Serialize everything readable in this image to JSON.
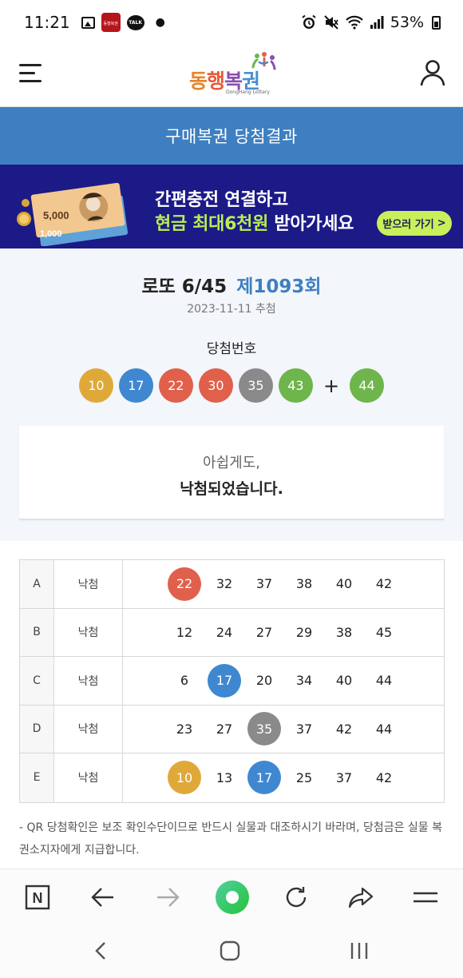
{
  "status_bar": {
    "time": "11:21",
    "app_icon_text": "동행복권",
    "talk_badge": "TALK",
    "battery": "53%"
  },
  "header": {
    "logo_text": [
      "동",
      "행",
      "복",
      "권"
    ],
    "logo_subtitle": "DongHang Lottery"
  },
  "title_band": "구매복권 당첨결과",
  "banner": {
    "line1": "간편충전 연결하고",
    "line2_highlight": "현금 최대6천원",
    "line2_rest": "받아가세요",
    "cta": "받으러 가기",
    "cta_arrow": ">",
    "bill_5000": "5,000",
    "bill_1000": "1,000"
  },
  "draw": {
    "game": "로또 6/45",
    "round": "제1093회",
    "date": "2023-11-11 추첨",
    "winning_label": "당첨번호",
    "numbers": [
      "10",
      "17",
      "22",
      "30",
      "35",
      "43"
    ],
    "plus": "+",
    "bonus": "44"
  },
  "colors": {
    "yellow": "#dfa93a",
    "blue": "#3f88d1",
    "red": "#e0604c",
    "gray": "#8a8a8a",
    "green": "#6eb54c",
    "band": "#3e7fc1",
    "banner_bg": "#1c1a86"
  },
  "message": {
    "line1": "아쉽게도,",
    "line2": "낙첨되었습니다."
  },
  "tickets": [
    {
      "game": "A",
      "result": "낙첨",
      "numbers": [
        "22",
        "32",
        "37",
        "38",
        "40",
        "42"
      ]
    },
    {
      "game": "B",
      "result": "낙첨",
      "numbers": [
        "12",
        "24",
        "27",
        "29",
        "38",
        "45"
      ]
    },
    {
      "game": "C",
      "result": "낙첨",
      "numbers": [
        "6",
        "17",
        "20",
        "34",
        "40",
        "44"
      ]
    },
    {
      "game": "D",
      "result": "낙첨",
      "numbers": [
        "23",
        "27",
        "35",
        "37",
        "42",
        "44"
      ]
    },
    {
      "game": "E",
      "result": "낙첨",
      "numbers": [
        "10",
        "13",
        "17",
        "25",
        "37",
        "42"
      ]
    }
  ],
  "note": "- QR 당첨확인은 보조 확인수단이므로 반드시 실물과 대조하시기 바라며, 당첨금은 실물 복권소지자에게 지급합니다.",
  "browser_bar": {
    "home_letter": "N"
  }
}
